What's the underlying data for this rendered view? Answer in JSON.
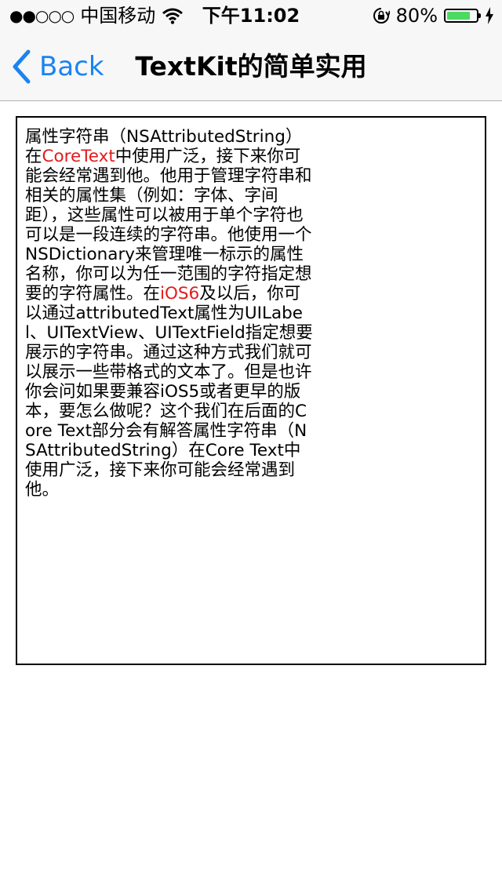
{
  "status_bar": {
    "signal_dots": "●●○○○",
    "carrier": "中国移动",
    "time": "下午11:02",
    "battery_percent": "80%",
    "battery_level": 0.8
  },
  "nav": {
    "back_label": "Back",
    "title": "TextKit的简单实用"
  },
  "text_view": {
    "segments": [
      {
        "text": "属性字符串（NSAttributedString）在",
        "highlight": false
      },
      {
        "text": "CoreText",
        "highlight": true
      },
      {
        "text": "中使用广泛，接下来你可能会经常遇到他。他用于管理字符串和相关的属性集（例如：字体、字间距），这些属性可以被用于单个字符也可以是一段连续的字符串。他使用一个NSDictionary来管理唯一标示的属性名称，你可以为任一范围的字符指定想要的字符属性。在",
        "highlight": false
      },
      {
        "text": "iOS6",
        "highlight": true
      },
      {
        "text": "及以后，你可以通过attributedText属性为UILabel、UITextView、UITextField指定想要展示的字符串。通过这种方式我们就可以展示一些带格式的文本了。但是也许你会问如果要兼容iOS5或者更早的版本，要怎么做呢？这个我们在后面的Core Text部分会有解答属性字符串（NSAttributedString）在Core Text中使用广泛，接下来你可能会经常遇到他。",
        "highlight": false
      }
    ],
    "highlight_color": "#e21c1c"
  },
  "colors": {
    "tint": "#1a84f0",
    "nav_background": "#f7f7f8",
    "battery_fill": "#4cd964"
  }
}
